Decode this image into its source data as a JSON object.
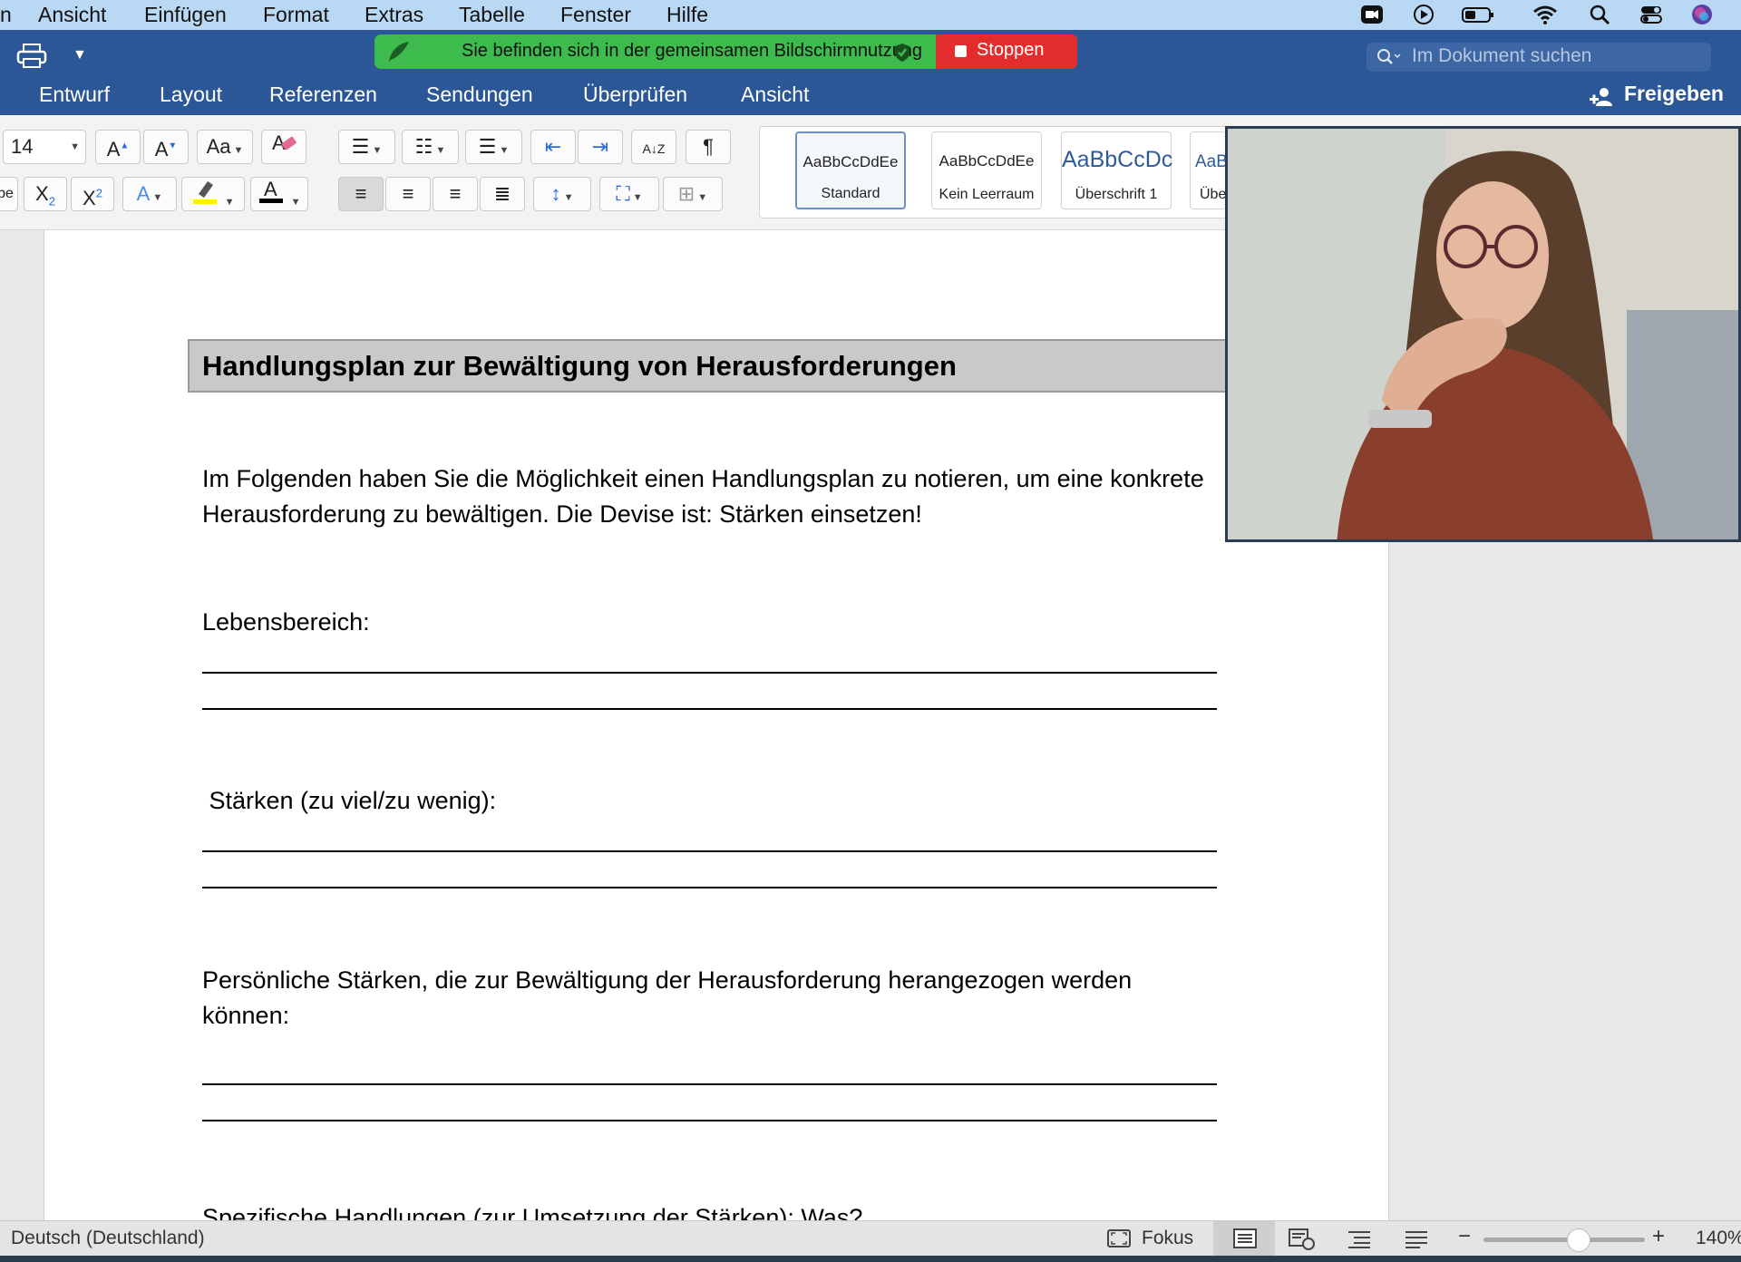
{
  "menubar": {
    "items": [
      "Ansicht",
      "Einfügen",
      "Format",
      "Extras",
      "Tabelle",
      "Fenster",
      "Hilfe"
    ],
    "partial_left": "n"
  },
  "share_banner": {
    "message": "Sie befinden sich in der gemeinsamen Bildschirmnutzung",
    "stop_label": "Stoppen"
  },
  "search": {
    "placeholder": "Im Dokument suchen"
  },
  "ribbon": {
    "tabs": [
      "Entwurf",
      "Layout",
      "Referenzen",
      "Sendungen",
      "Überprüfen",
      "Ansicht"
    ],
    "share_label": "Freigeben"
  },
  "toolbar": {
    "font_size": "14",
    "styles": [
      {
        "sample": "AaBbCcDdEe",
        "name": "Standard"
      },
      {
        "sample": "AaBbCcDdEe",
        "name": "Kein Leerraum"
      },
      {
        "sample": "AaBbCcDc",
        "name": "Überschrift 1"
      },
      {
        "sample": "AaB",
        "name": "Übe"
      }
    ]
  },
  "document": {
    "heading": "Handlungsplan zur Bewältigung von Herausforderungen",
    "intro_line1": "Im Folgenden haben Sie die Möglichkeit einen Handlungsplan zu notieren, um eine konkrete",
    "intro_line2": "Herausforderung zu bewältigen. Die Devise ist: Stärken einsetzen!",
    "label_lebensbereich": "Lebensbereich:",
    "label_staerken": " Stärken (zu viel/zu wenig):",
    "label_persoenlich_line1": "Persönliche Stärken, die zur Bewältigung der Herausforderung herangezogen werden",
    "label_persoenlich_line2": "können:",
    "label_spezifisch": "Spezifische Handlungen (zur Umsetzung der Stärken): Was?"
  },
  "statusbar": {
    "language": "Deutsch (Deutschland)",
    "focus_label": "Fokus",
    "zoom": "140%"
  }
}
